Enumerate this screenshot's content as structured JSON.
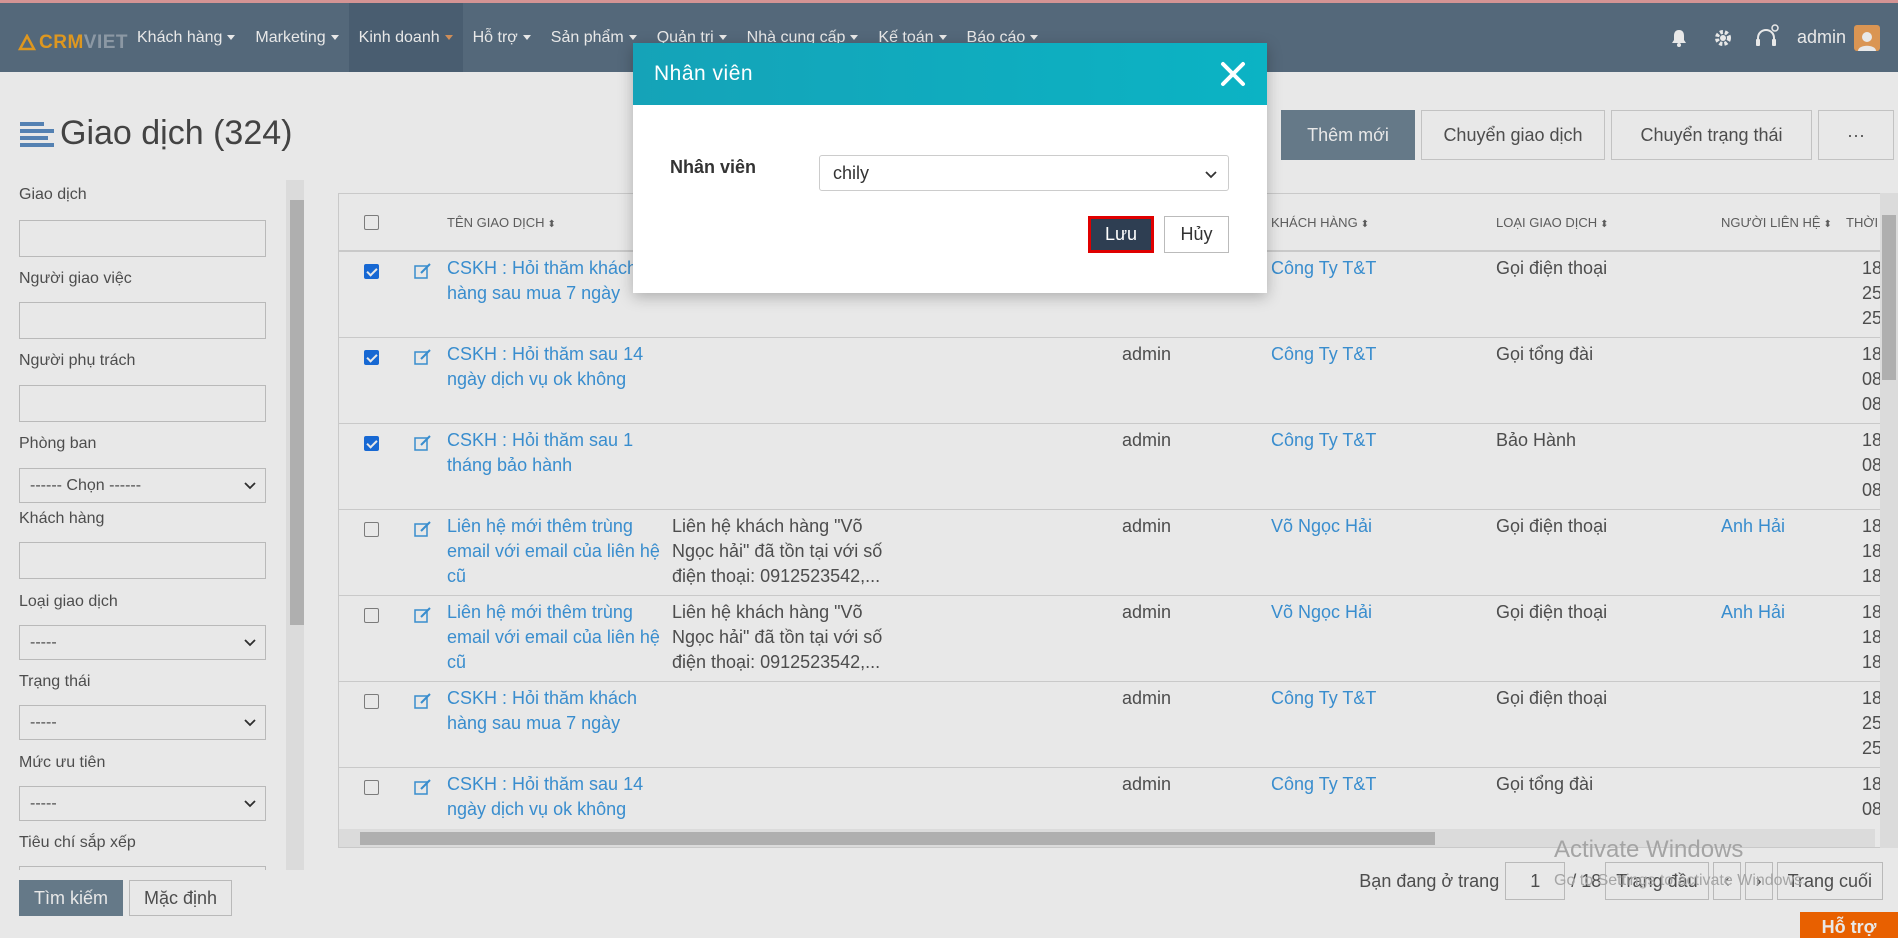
{
  "brand": {
    "logo_left": "CRM",
    "logo_right": "VIET"
  },
  "nav": {
    "items": [
      {
        "label": "Khách hàng"
      },
      {
        "label": "Marketing"
      },
      {
        "label": "Kinh doanh"
      },
      {
        "label": "Hỗ trợ"
      },
      {
        "label": "Sản phẩm"
      },
      {
        "label": "Quản trị"
      },
      {
        "label": "Nhà cung cấp"
      },
      {
        "label": "Kế toán"
      },
      {
        "label": "Báo cáo"
      }
    ],
    "user": "admin",
    "icons": [
      "bell-icon",
      "gear-icon",
      "headset-icon"
    ]
  },
  "page": {
    "title": "Giao dịch (324)"
  },
  "actions": {
    "add": "Thêm mới",
    "transfer": "Chuyển giao dịch",
    "status": "Chuyển trạng thái",
    "more": "···"
  },
  "filters": {
    "transaction_label": "Giao dịch",
    "assigner_label": "Người giao việc",
    "owner_label": "Người phụ trách",
    "department_label": "Phòng ban",
    "department_value": "------ Chọn ------",
    "customer_label": "Khách hàng",
    "type_label": "Loại giao dịch",
    "type_value": "-----",
    "status_label": "Trạng thái",
    "status_value": "-----",
    "priority_label": "Mức ưu tiên",
    "priority_value": "-----",
    "sort_label": "Tiêu chí sắp xếp",
    "search_btn": "Tìm kiếm",
    "default_btn": "Mặc định"
  },
  "table": {
    "headers": {
      "name": "TÊN GIAO DỊCH",
      "customer": "KHÁCH HÀNG",
      "type": "LOẠI GIAO DỊCH",
      "contact": "NGƯỜI LIÊN HỆ",
      "time": "THỜI"
    },
    "rows": [
      {
        "checked": true,
        "name1": "CSKH : Hỏi thăm khách",
        "name2": "hàng sau mua 7 ngày",
        "name3": "",
        "desc1": "",
        "desc2": "",
        "desc3": "",
        "owner": "",
        "customer": "Công Ty T&T",
        "type": "Gọi điện thoại",
        "contact": "",
        "t1": "18",
        "t2": "25",
        "t3": "25"
      },
      {
        "checked": true,
        "name1": "CSKH : Hỏi thăm sau 14",
        "name2": "ngày dịch vụ ok không",
        "name3": "",
        "desc1": "",
        "desc2": "",
        "desc3": "",
        "owner": "admin",
        "customer": "Công Ty T&T",
        "type": "Gọi tổng đài",
        "contact": "",
        "t1": "18",
        "t2": "08",
        "t3": "08"
      },
      {
        "checked": true,
        "name1": "CSKH : Hỏi thăm sau 1",
        "name2": "tháng bảo hành",
        "name3": "",
        "desc1": "",
        "desc2": "",
        "desc3": "",
        "owner": "admin",
        "customer": "Công Ty T&T",
        "type": "Bảo Hành",
        "contact": "",
        "t1": "18",
        "t2": "08",
        "t3": "08"
      },
      {
        "checked": false,
        "name1": "Liên hệ mới thêm trùng",
        "name2": "email với email của liên hệ",
        "name3": "cũ",
        "desc1": "Liên hệ khách hàng \"Võ",
        "desc2": "Ngọc hải\" đã tồn tại với số",
        "desc3": "điện thoại: 0912523542,...",
        "owner": "admin",
        "customer": "Võ Ngọc Hải",
        "type": "Gọi điện thoại",
        "contact": "Anh Hải",
        "t1": "18",
        "t2": "18",
        "t3": "18"
      },
      {
        "checked": false,
        "name1": "Liên hệ mới thêm trùng",
        "name2": "email với email của liên hệ",
        "name3": "cũ",
        "desc1": "Liên hệ khách hàng \"Võ",
        "desc2": "Ngọc hải\" đã tồn tại với số",
        "desc3": "điện thoại: 0912523542,...",
        "owner": "admin",
        "customer": "Võ Ngọc Hải",
        "type": "Gọi điện thoại",
        "contact": "Anh Hải",
        "t1": "18",
        "t2": "18",
        "t3": "18"
      },
      {
        "checked": false,
        "name1": "CSKH : Hỏi thăm khách",
        "name2": "hàng sau mua 7 ngày",
        "name3": "",
        "desc1": "",
        "desc2": "",
        "desc3": "",
        "owner": "admin",
        "customer": "Công Ty T&T",
        "type": "Gọi điện thoại",
        "contact": "",
        "t1": "18",
        "t2": "25",
        "t3": "25"
      },
      {
        "checked": false,
        "name1": "CSKH : Hỏi thăm sau 14",
        "name2": "ngày dịch vụ ok không",
        "name3": "",
        "desc1": "",
        "desc2": "",
        "desc3": "",
        "owner": "admin",
        "customer": "Công Ty T&T",
        "type": "Gọi tổng đài",
        "contact": "",
        "t1": "18",
        "t2": "08",
        "t3": ""
      }
    ]
  },
  "pager": {
    "label": "Bạn đang ở trang",
    "page": "1",
    "total": "/ 18",
    "first": "Trang đầu",
    "prev": "‹",
    "next": "›",
    "last": "Trang cuối"
  },
  "watermark": {
    "line1": "Activate Windows",
    "line2": "Go to Settings to activate Windows."
  },
  "help_button": "Hỗ trợ",
  "modal": {
    "title": "Nhân viên",
    "field_label": "Nhân viên",
    "field_value": "chily",
    "save": "Lưu",
    "cancel": "Hủy"
  }
}
